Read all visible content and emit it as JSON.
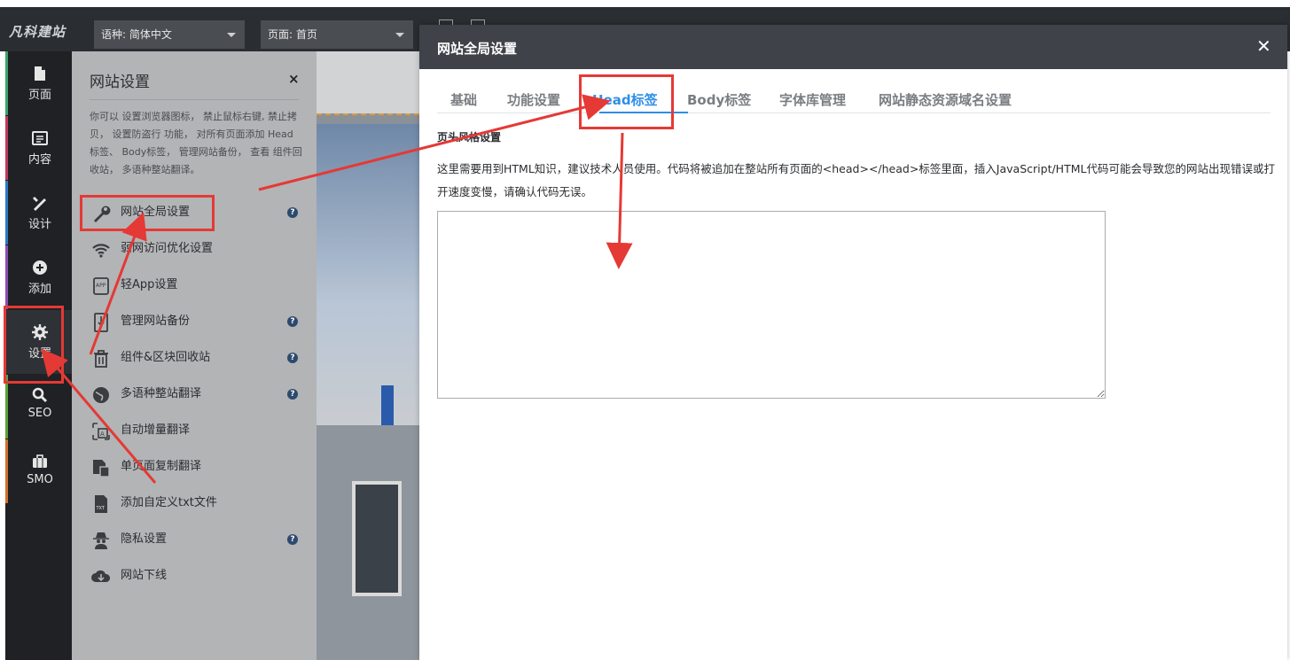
{
  "topbar": {
    "logo": "凡科建站",
    "language_label": "语种: 简体中文",
    "page_label": "页面: 首页"
  },
  "sidebar": {
    "items": [
      {
        "label": "页面",
        "icon": "page-icon",
        "color": "#3aa56a"
      },
      {
        "label": "内容",
        "icon": "content-icon",
        "color": "#c23a5a"
      },
      {
        "label": "设计",
        "icon": "design-icon",
        "color": "#2c79c9"
      },
      {
        "label": "添加",
        "icon": "add-icon",
        "color": "#8a4fb3"
      },
      {
        "label": "设置",
        "icon": "gear-icon",
        "color": "#2e3135"
      },
      {
        "label": "SEO",
        "icon": "search-icon",
        "color": "#5aa23a"
      },
      {
        "label": "SMO",
        "icon": "briefcase-icon",
        "color": "#d3702b"
      }
    ]
  },
  "panel": {
    "title": "网站设置",
    "close": "×",
    "description": "你可以 设置浏览器图标， 禁止鼠标右键, 禁止拷贝， 设置防盗行 功能， 对所有页面添加 Head标签、 Body标签， 管理网站备份， 查看 组件回收站， 多语种整站翻译。",
    "items": [
      {
        "label": "网站全局设置",
        "icon": "wrench-icon",
        "help": true
      },
      {
        "label": "弱网访问优化设置",
        "icon": "wifi-icon",
        "help": false
      },
      {
        "label": "轻App设置",
        "icon": "app-icon",
        "help": false
      },
      {
        "label": "管理网站备份",
        "icon": "backup-icon",
        "help": true
      },
      {
        "label": "组件&区块回收站",
        "icon": "trash-icon",
        "help": true
      },
      {
        "label": "多语种整站翻译",
        "icon": "globe-icon",
        "help": true
      },
      {
        "label": "自动增量翻译",
        "icon": "translate-icon",
        "help": false
      },
      {
        "label": "单页面复制翻译",
        "icon": "copy-page-icon",
        "help": false
      },
      {
        "label": "添加自定义txt文件",
        "icon": "txt-file-icon",
        "help": false
      },
      {
        "label": "隐私设置",
        "icon": "spy-icon",
        "help": true
      },
      {
        "label": "网站下线",
        "icon": "cloud-download-icon",
        "help": false
      }
    ],
    "help_glyph": "?"
  },
  "dialog": {
    "title": "网站全局设置",
    "close": "✕",
    "tabs": [
      {
        "label": "基础",
        "active": false
      },
      {
        "label": "功能设置",
        "active": false
      },
      {
        "label": "Head标签",
        "active": true
      },
      {
        "label": "Body标签",
        "active": false
      },
      {
        "label": "字体库管理",
        "active": false
      },
      {
        "label": "网站静态资源域名设置",
        "active": false
      }
    ],
    "section_title": "页头风格设置",
    "note": "这里需要用到HTML知识，建议技术人员使用。代码将被追加在整站所有页面的<head></head>标签里面，插入JavaScript/HTML代码可能会导致您的网站出现错误或打开速度变慢，请确认代码无误。",
    "code_value": ""
  },
  "colors": {
    "accent": "#2f8ee6",
    "annotation": "#e53935",
    "dark": "#2a2d31"
  }
}
